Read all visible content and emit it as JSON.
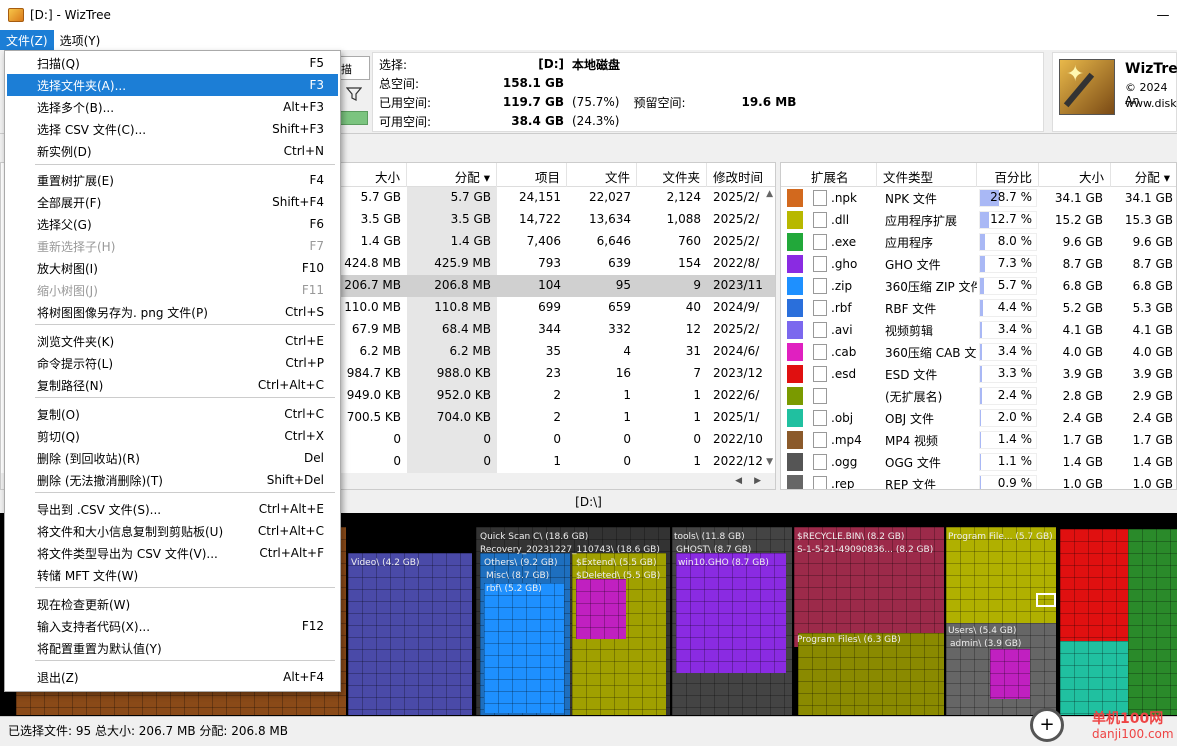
{
  "window": {
    "title": "[D:]  - WizTree",
    "minimize": "—"
  },
  "menubar": {
    "items": [
      "文件(Z)",
      "选项(Y)"
    ]
  },
  "file_menu": {
    "items": [
      {
        "label": "扫描(Q)",
        "shortcut": "F5"
      },
      {
        "label": "选择文件夹(A)...",
        "shortcut": "F3"
      },
      {
        "label": "选择多个(B)...",
        "shortcut": "Alt+F3"
      },
      {
        "label": "选择 CSV 文件(C)...",
        "shortcut": "Shift+F3"
      },
      {
        "label": "新实例(D)",
        "shortcut": "Ctrl+N"
      },
      {
        "label": "重置树扩展(E)",
        "shortcut": "F4"
      },
      {
        "label": "全部展开(F)",
        "shortcut": "Shift+F4"
      },
      {
        "label": "选择父(G)",
        "shortcut": "F6"
      },
      {
        "label": "重新选择子(H)",
        "shortcut": "F7"
      },
      {
        "label": "放大树图(I)",
        "shortcut": "F10"
      },
      {
        "label": "缩小树图(J)",
        "shortcut": "F11"
      },
      {
        "label": "将树图图像另存为. png 文件(P)",
        "shortcut": "Ctrl+S"
      },
      {
        "label": "浏览文件夹(K)",
        "shortcut": "Ctrl+E"
      },
      {
        "label": "命令提示符(L)",
        "shortcut": "Ctrl+P"
      },
      {
        "label": "复制路径(N)",
        "shortcut": "Ctrl+Alt+C"
      },
      {
        "label": "复制(O)",
        "shortcut": "Ctrl+C"
      },
      {
        "label": "剪切(Q)",
        "shortcut": "Ctrl+X"
      },
      {
        "label": "删除 (到回收站)(R)",
        "shortcut": "Del"
      },
      {
        "label": "删除 (无法撤消删除)(T)",
        "shortcut": "Shift+Del"
      },
      {
        "label": "导出到 .CSV 文件(S)...",
        "shortcut": "Ctrl+Alt+E"
      },
      {
        "label": "将文件和大小信息复制到剪贴板(U)",
        "shortcut": "Ctrl+Alt+C"
      },
      {
        "label": "将文件类型导出为 CSV 文件(V)...",
        "shortcut": "Ctrl+Alt+F"
      },
      {
        "label": "转储 MFT 文件(W)",
        "shortcut": ""
      },
      {
        "label": "现在检查更新(W)",
        "shortcut": ""
      },
      {
        "label": "输入支持者代码(X)...",
        "shortcut": "F12"
      },
      {
        "label": "将配置重置为默认值(Y)",
        "shortcut": ""
      },
      {
        "label": "退出(Z)",
        "shortcut": "Alt+F4"
      }
    ]
  },
  "scan": {
    "button": "描"
  },
  "info": {
    "select_label": "选择:",
    "drive": "[D:]",
    "drive_name": "本地磁盘",
    "total_label": "总空间:",
    "total": "158.1 GB",
    "used_label": "已用空间:",
    "used": "119.7 GB",
    "used_pct": "(75.7%)",
    "reserved_label": "预留空间:",
    "reserved": "19.6 MB",
    "free_label": "可用空间:",
    "free": "38.4 GB",
    "free_pct": "(24.3%)"
  },
  "logo": {
    "name": "WizTree",
    "line1": "© 2024 An",
    "line2": "www.disk"
  },
  "tree": {
    "headers": [
      "大小",
      "分配",
      "项目",
      "文件",
      "文件夹",
      "修改时间"
    ],
    "rows": [
      [
        "5.7 GB",
        "5.7 GB",
        "24,151",
        "22,027",
        "2,124",
        "2025/2/"
      ],
      [
        "3.5 GB",
        "3.5 GB",
        "14,722",
        "13,634",
        "1,088",
        "2025/2/"
      ],
      [
        "1.4 GB",
        "1.4 GB",
        "7,406",
        "6,646",
        "760",
        "2025/2/"
      ],
      [
        "424.8 MB",
        "425.9 MB",
        "793",
        "639",
        "154",
        "2022/8/"
      ],
      [
        "206.7 MB",
        "206.8 MB",
        "104",
        "95",
        "9",
        "2023/11"
      ],
      [
        "110.0 MB",
        "110.8 MB",
        "699",
        "659",
        "40",
        "2024/9/"
      ],
      [
        "67.9 MB",
        "68.4 MB",
        "344",
        "332",
        "12",
        "2025/2/"
      ],
      [
        "6.2 MB",
        "6.2 MB",
        "35",
        "4",
        "31",
        "2024/6/"
      ],
      [
        "984.7 KB",
        "988.0 KB",
        "23",
        "16",
        "7",
        "2023/12"
      ],
      [
        "949.0 KB",
        "952.0 KB",
        "2",
        "1",
        "1",
        "2022/6/"
      ],
      [
        "700.5 KB",
        "704.0 KB",
        "2",
        "1",
        "1",
        "2025/1/"
      ],
      [
        "0",
        "0",
        "0",
        "0",
        "0",
        "2022/10"
      ],
      [
        "0",
        "0",
        "1",
        "0",
        "1",
        "2022/12"
      ]
    ]
  },
  "ext": {
    "headers": [
      "扩展名",
      "文件类型",
      "百分比",
      "大小",
      "分配"
    ],
    "rows": [
      {
        "color": "#d2691e",
        "ext": ".npk",
        "type": "NPK 文件",
        "pct": "28.7 %",
        "pv": 28.7,
        "size": "34.1 GB",
        "alloc": "34.1 GB"
      },
      {
        "color": "#b8b800",
        "ext": ".dll",
        "type": "应用程序扩展",
        "pct": "12.7 %",
        "pv": 12.7,
        "size": "15.2 GB",
        "alloc": "15.3 GB"
      },
      {
        "color": "#22a83a",
        "ext": ".exe",
        "type": "应用程序",
        "pct": "8.0 %",
        "pv": 8.0,
        "size": "9.6 GB",
        "alloc": "9.6 GB"
      },
      {
        "color": "#8a2be2",
        "ext": ".gho",
        "type": "GHO 文件",
        "pct": "7.3 %",
        "pv": 7.3,
        "size": "8.7 GB",
        "alloc": "8.7 GB"
      },
      {
        "color": "#1e90ff",
        "ext": ".zip",
        "type": "360压缩 ZIP 文件",
        "pct": "5.7 %",
        "pv": 5.7,
        "size": "6.8 GB",
        "alloc": "6.8 GB"
      },
      {
        "color": "#2a6fdb",
        "ext": ".rbf",
        "type": "RBF 文件",
        "pct": "4.4 %",
        "pv": 4.4,
        "size": "5.2 GB",
        "alloc": "5.3 GB"
      },
      {
        "color": "#7b68ee",
        "ext": ".avi",
        "type": "视频剪辑",
        "pct": "3.4 %",
        "pv": 3.4,
        "size": "4.1 GB",
        "alloc": "4.1 GB"
      },
      {
        "color": "#e020c0",
        "ext": ".cab",
        "type": "360压缩 CAB 文件",
        "pct": "3.4 %",
        "pv": 3.4,
        "size": "4.0 GB",
        "alloc": "4.0 GB"
      },
      {
        "color": "#e01010",
        "ext": ".esd",
        "type": "ESD 文件",
        "pct": "3.3 %",
        "pv": 3.3,
        "size": "3.9 GB",
        "alloc": "3.9 GB"
      },
      {
        "color": "#7a9a00",
        "ext": "",
        "type": "(无扩展名)",
        "pct": "2.4 %",
        "pv": 2.4,
        "size": "2.8 GB",
        "alloc": "2.9 GB"
      },
      {
        "color": "#20c0a0",
        "ext": ".obj",
        "type": "OBJ 文件",
        "pct": "2.0 %",
        "pv": 2.0,
        "size": "2.4 GB",
        "alloc": "2.4 GB"
      },
      {
        "color": "#8b5a2b",
        "ext": ".mp4",
        "type": "MP4 视频",
        "pct": "1.4 %",
        "pv": 1.4,
        "size": "1.7 GB",
        "alloc": "1.7 GB"
      },
      {
        "color": "#555555",
        "ext": ".ogg",
        "type": "OGG 文件",
        "pct": "1.1 %",
        "pv": 1.1,
        "size": "1.4 GB",
        "alloc": "1.4 GB"
      },
      {
        "color": "#666666",
        "ext": ".rep",
        "type": "REP 文件",
        "pct": "0.9 %",
        "pv": 0.9,
        "size": "1.0 GB",
        "alloc": "1.0 GB"
      }
    ]
  },
  "path": "[D:\\]",
  "treemap": {
    "labels": [
      "Video\\ (4.2 GB)",
      "Quick Scan C\\ (18.6 GB)",
      "Recovery_20231227_110743\\ (18.6 GB)",
      "Others\\ (9.2 GB)",
      "Misc\\ (8.7 GB)",
      "rbf\\ (5.2 GB)",
      "$Extend\\ (5.5 GB)",
      "$Deleted\\ (5.5 GB)",
      "tools\\ (11.8 GB)",
      "GHOST\\ (8.7 GB)",
      "win10.GHO (8.7 GB)",
      "$RECYCLE.BIN\\ (8.2 GB)",
      "S-1-5-21-49090836... (8.2 GB)",
      "Program Files\\ (6.3 GB)",
      "Program File... (5.7 GB)",
      "Users\\ (5.4 GB)",
      "admin\\ (3.9 GB)"
    ]
  },
  "status": {
    "text": "已选择文件: 95  总大小: 206.7 MB  分配: 206.8 MB"
  },
  "watermark": {
    "line1": "单机100网",
    "line2": "danji100.com",
    "plus": "+"
  }
}
